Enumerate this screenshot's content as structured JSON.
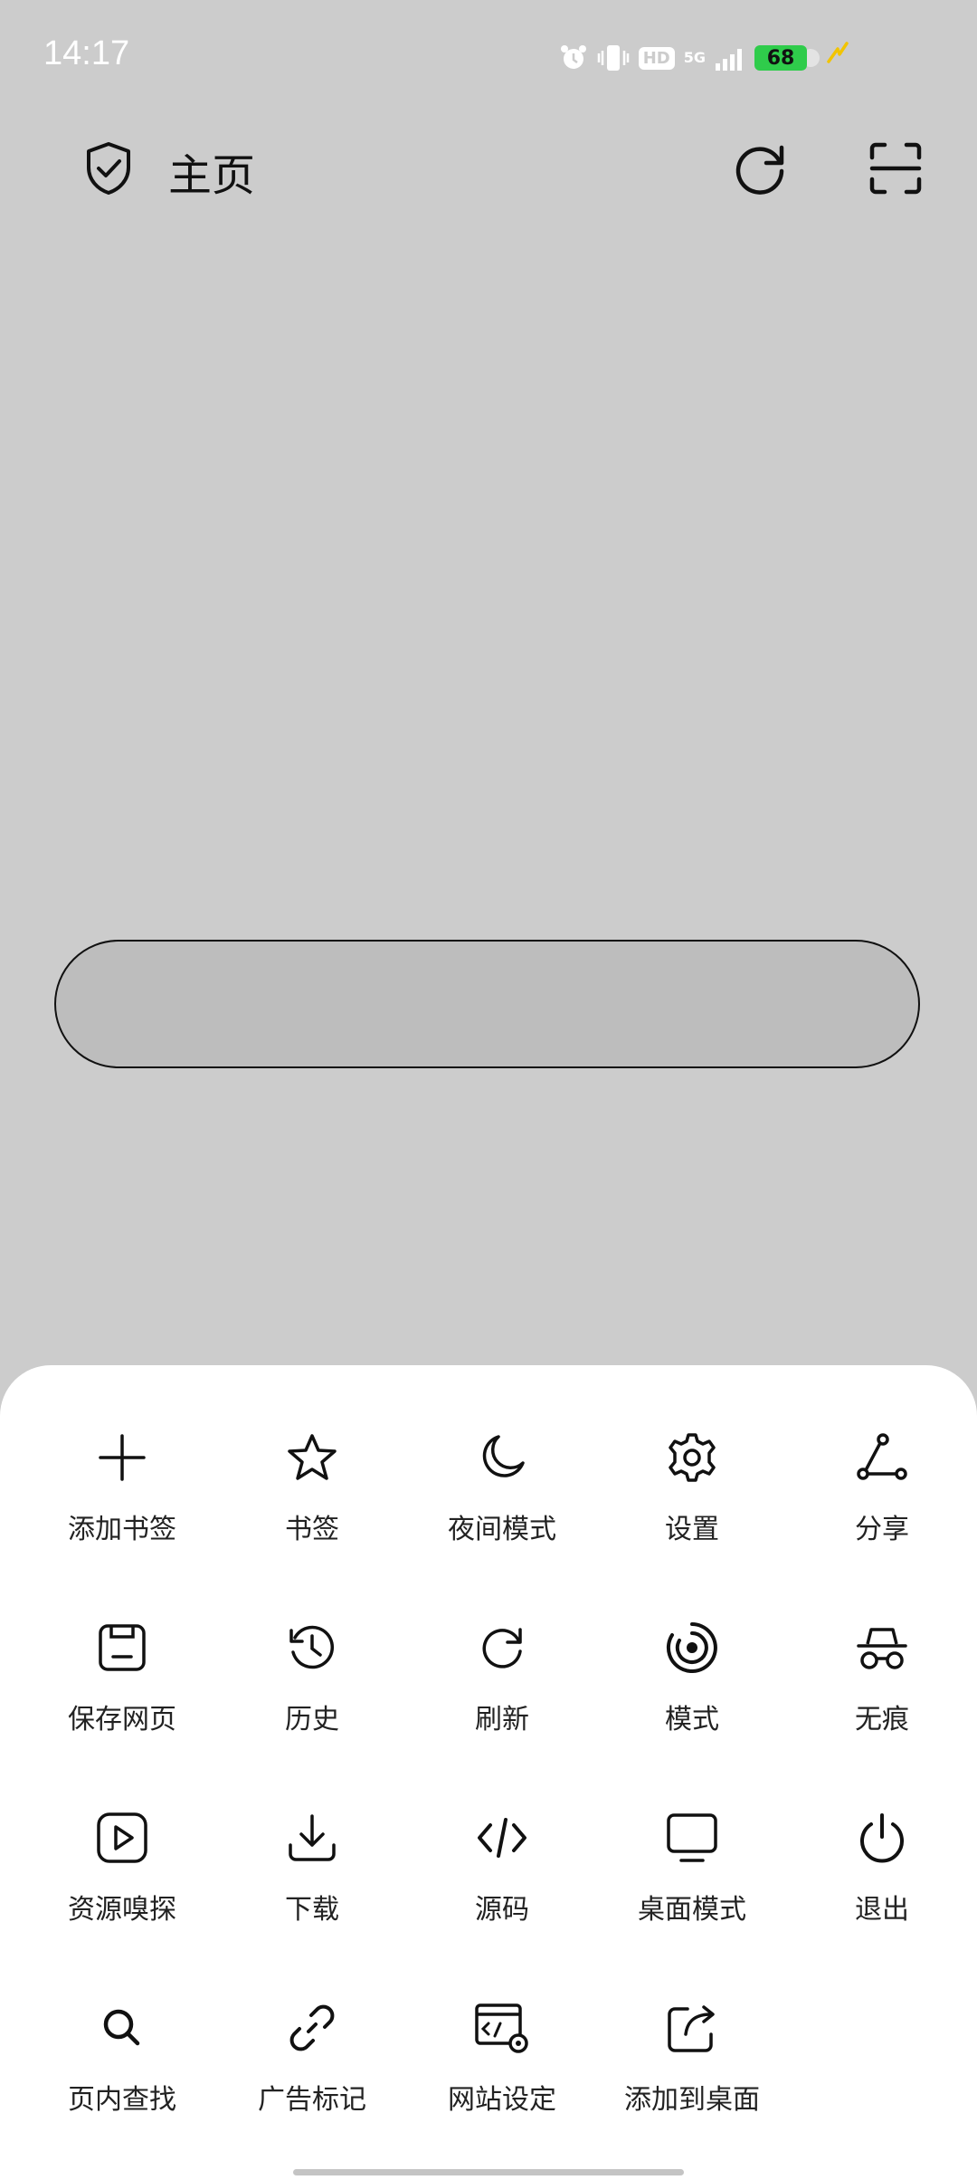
{
  "status_bar": {
    "time": "14:17",
    "hd": "HD",
    "network": "5G",
    "battery": "68"
  },
  "top_bar": {
    "title": "主页"
  },
  "search_bar": {
    "placeholder": ""
  },
  "menu": {
    "items": [
      {
        "label": "添加书签",
        "icon": "plus-icon"
      },
      {
        "label": "书签",
        "icon": "star-icon"
      },
      {
        "label": "夜间模式",
        "icon": "moon-icon"
      },
      {
        "label": "设置",
        "icon": "gear-icon"
      },
      {
        "label": "分享",
        "icon": "share-icon"
      },
      {
        "label": "保存网页",
        "icon": "save-icon"
      },
      {
        "label": "历史",
        "icon": "history-icon"
      },
      {
        "label": "刷新",
        "icon": "refresh-icon"
      },
      {
        "label": "模式",
        "icon": "mode-icon"
      },
      {
        "label": "无痕",
        "icon": "incognito-icon"
      },
      {
        "label": "资源嗅探",
        "icon": "media-sniff-icon"
      },
      {
        "label": "下载",
        "icon": "download-icon"
      },
      {
        "label": "源码",
        "icon": "code-icon"
      },
      {
        "label": "桌面模式",
        "icon": "monitor-icon"
      },
      {
        "label": "退出",
        "icon": "power-icon"
      },
      {
        "label": "页内查找",
        "icon": "search-icon"
      },
      {
        "label": "广告标记",
        "icon": "link-icon"
      },
      {
        "label": "网站设定",
        "icon": "site-settings-icon"
      },
      {
        "label": "添加到桌面",
        "icon": "add-to-desktop-icon"
      }
    ]
  }
}
